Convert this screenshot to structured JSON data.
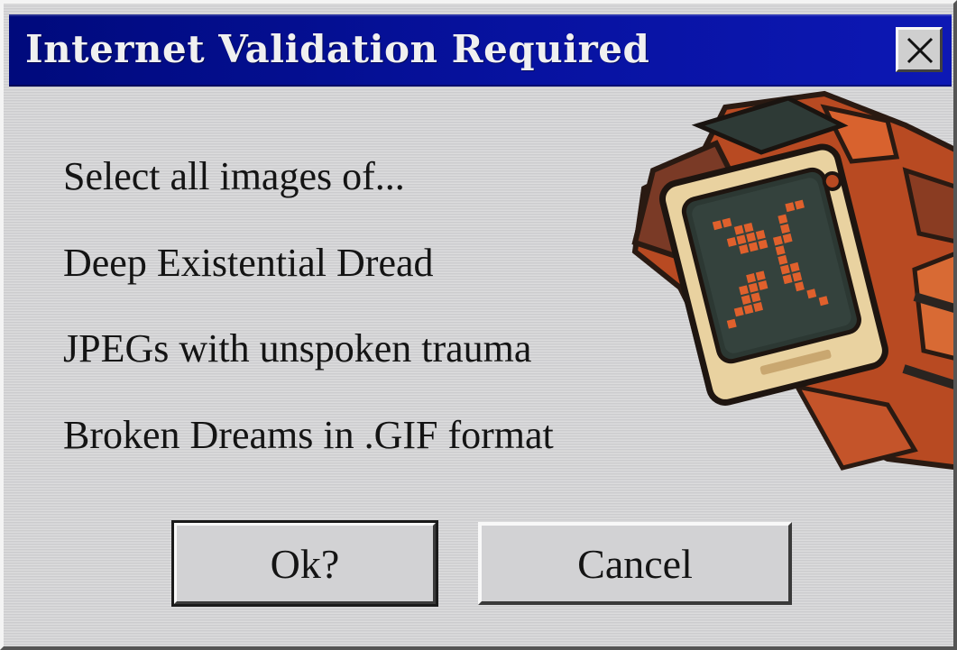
{
  "window": {
    "title": "Internet Validation Required",
    "title_bar_color": "#0712a0"
  },
  "close_button": {
    "icon": "close-icon"
  },
  "message": {
    "prompt": "Select all images of...",
    "options": [
      "Deep Existential Dread",
      "JPEGs with unspoken trauma",
      "Broken Dreams in .GIF format"
    ]
  },
  "buttons": {
    "ok_label": "Ok?",
    "cancel_label": "Cancel"
  },
  "mascot": {
    "icon": "sad-monitor-robot-icon",
    "accent_color": "#d85a2a"
  }
}
